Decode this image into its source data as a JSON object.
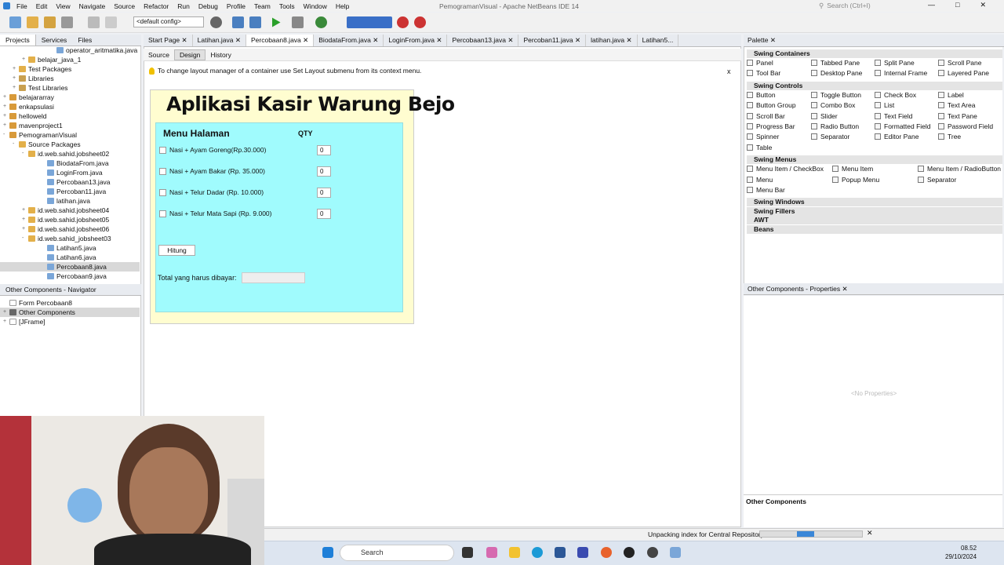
{
  "window": {
    "title": "PemogramanVisual - Apache NetBeans IDE 14",
    "search_placeholder": "Search (Ctrl+I)"
  },
  "menu": [
    "File",
    "Edit",
    "View",
    "Navigate",
    "Source",
    "Refactor",
    "Run",
    "Debug",
    "Profile",
    "Team",
    "Tools",
    "Window",
    "Help"
  ],
  "toolbar": {
    "config": "<default config>"
  },
  "projects_tabs": [
    "Projects",
    "Services",
    "Files"
  ],
  "tree": [
    {
      "label": "operator_aritmatika.java",
      "indent": 5,
      "icon": "java"
    },
    {
      "label": "belajar_java_1",
      "indent": 2,
      "icon": "pkg",
      "tog": "+"
    },
    {
      "label": "Test Packages",
      "indent": 1,
      "icon": "pkg",
      "tog": "+"
    },
    {
      "label": "Libraries",
      "indent": 1,
      "icon": "lib",
      "tog": "+"
    },
    {
      "label": "Test Libraries",
      "indent": 1,
      "icon": "lib",
      "tog": "+"
    },
    {
      "label": "belajararray",
      "indent": 0,
      "icon": "proj",
      "tog": "+"
    },
    {
      "label": "enkapsulasi",
      "indent": 0,
      "icon": "proj",
      "tog": "+"
    },
    {
      "label": "helloweld",
      "indent": 0,
      "icon": "proj",
      "tog": "+"
    },
    {
      "label": "mavenproject1",
      "indent": 0,
      "icon": "proj",
      "tog": "+"
    },
    {
      "label": "PemogramanVisual",
      "indent": 0,
      "icon": "proj",
      "tog": "-"
    },
    {
      "label": "Source Packages",
      "indent": 1,
      "icon": "pkg",
      "tog": "-"
    },
    {
      "label": "id.web.sahid.jobsheet02",
      "indent": 2,
      "icon": "pkg",
      "tog": "-"
    },
    {
      "label": "BiodataFrom.java",
      "indent": 4,
      "icon": "java"
    },
    {
      "label": "LoginFrom.java",
      "indent": 4,
      "icon": "java"
    },
    {
      "label": "Percobaan13.java",
      "indent": 4,
      "icon": "java"
    },
    {
      "label": "Percoban11.java",
      "indent": 4,
      "icon": "java"
    },
    {
      "label": "latihan.java",
      "indent": 4,
      "icon": "java"
    },
    {
      "label": "id.web.sahid.jobsheet04",
      "indent": 2,
      "icon": "pkg",
      "tog": "+"
    },
    {
      "label": "id.web.sahid.jobsheet05",
      "indent": 2,
      "icon": "pkg",
      "tog": "+"
    },
    {
      "label": "id.web.sahid.jobsheet06",
      "indent": 2,
      "icon": "pkg",
      "tog": "+"
    },
    {
      "label": "id.web.sahid_jobsheet03",
      "indent": 2,
      "icon": "pkg",
      "tog": "-"
    },
    {
      "label": "Latihan5.java",
      "indent": 4,
      "icon": "java"
    },
    {
      "label": "Latihan6.java",
      "indent": 4,
      "icon": "java"
    },
    {
      "label": "Percobaan8.java",
      "indent": 4,
      "icon": "java",
      "sel": true
    },
    {
      "label": "Percobaan9.java",
      "indent": 4,
      "icon": "java"
    }
  ],
  "navigator": {
    "title": "Other Components - Navigator",
    "items": [
      "Form Percobaan8",
      "Other Components",
      "[JFrame]"
    ]
  },
  "editor_tabs": [
    "Start Page",
    "Latihan.java",
    "Percobaan8.java",
    "BiodataFrom.java",
    "LoginFrom.java",
    "Percobaan13.java",
    "Percoban11.java",
    "latihan.java",
    "Latihan5..."
  ],
  "sub_tabs": [
    "Source",
    "Design",
    "History"
  ],
  "hint": "To change layout manager of a container use Set Layout submenu from its context menu.",
  "form": {
    "title": "Aplikasi Kasir Warung Bejo",
    "menu_label": "Menu Halaman",
    "qty_label": "QTY",
    "items": [
      {
        "label": "Nasi + Ayam Goreng(Rp.30.000)",
        "qty": "0"
      },
      {
        "label": "Nasi + Ayam Bakar (Rp. 35.000)",
        "qty": "0"
      },
      {
        "label": "Nasi + Telur Dadar (Rp. 10.000)",
        "qty": "0"
      },
      {
        "label": "Nasi + Telur Mata Sapi (Rp. 9.000)",
        "qty": "0"
      }
    ],
    "button": "Hitung",
    "total_label": "Total yang harus dibayar:"
  },
  "palette": {
    "title": "Palette",
    "categories": [
      {
        "name": "Swing Containers",
        "items": [
          "Panel",
          "Tabbed Pane",
          "Split Pane",
          "Scroll Pane",
          "Tool Bar",
          "Desktop Pane",
          "Internal Frame",
          "Layered Pane"
        ]
      },
      {
        "name": "Swing Controls",
        "items": [
          "Button",
          "Toggle Button",
          "Check Box",
          "Label",
          "Button Group",
          "Combo Box",
          "List",
          "Text Area",
          "Scroll Bar",
          "Slider",
          "Text Field",
          "Text Pane",
          "Progress Bar",
          "Radio Button",
          "Formatted Field",
          "Password Field",
          "Spinner",
          "Separator",
          "Editor Pane",
          "Tree",
          "Table"
        ]
      },
      {
        "name": "Swing Menus",
        "items": [
          "Menu Item / CheckBox",
          "Menu Item",
          "Menu Item / RadioButton",
          "Menu",
          "Popup Menu",
          "Separator",
          "Menu Bar"
        ]
      }
    ],
    "collapsed": [
      "Swing Windows",
      "Swing Fillers",
      "AWT",
      "Beans"
    ]
  },
  "properties": {
    "title": "Other Components - Properties",
    "empty": "<No Properties>"
  },
  "other_components": "Other Components",
  "status": {
    "text": "Unpacking index for Central Repository",
    "progress": 0.17
  },
  "taskbar": {
    "search": "Search",
    "time": "08.52",
    "date": "29/10/2024"
  },
  "colors": {
    "panel_bg": "#a0fbfd",
    "frame_bg": "#fffdd0",
    "progress": "#3a87d8"
  }
}
